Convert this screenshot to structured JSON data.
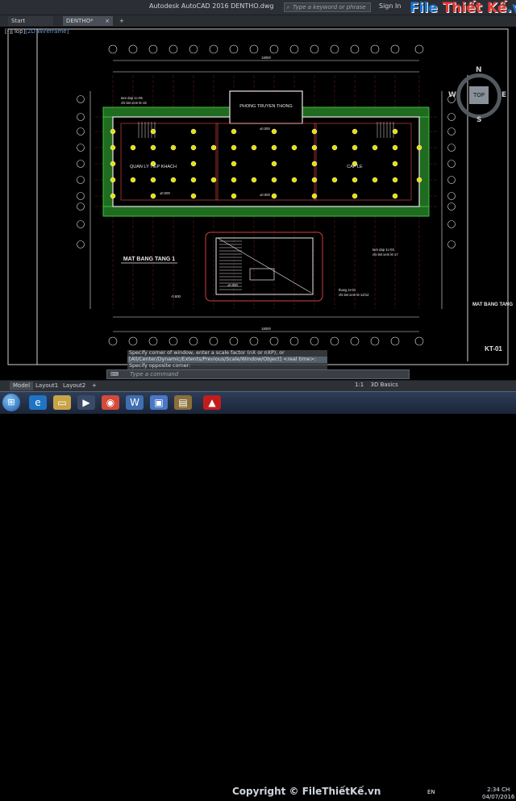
{
  "window": {
    "title": "Autodesk AutoCAD 2016    DENTHO.dwg",
    "search_placeholder": "Type a keyword or phrase",
    "sign_in": "Sign In",
    "logo_main": "File",
    "logo_accent": "Thiết Kế",
    "logo_suffix": ".vn"
  },
  "tabs": {
    "start": "Start",
    "drawing": "DENTHO*",
    "close": "×",
    "add": "+"
  },
  "viewport": {
    "view_label": "[-][Top]",
    "visual_style": "[2D Wireframe]",
    "viewcube": {
      "top": "TOP",
      "north": "N",
      "south": "S",
      "east": "E",
      "west": "W"
    }
  },
  "drawing": {
    "room_1": "PHONG TRUYEN THONG",
    "room_2": "QUAN LY TIEP KHACH",
    "room_3": "CAP LE",
    "plan_title": "MAT BANG TANG 1",
    "side_title": "MAT BANG TANG",
    "sheet_id": "KT-01",
    "note_1": "tam dap 1c-05",
    "note_1b": "chi tiet xem kt-18",
    "note_2": "tam dap 1c-03",
    "note_2b": "chi tiet xem kt-17",
    "note_3": "thang 1t-01",
    "note_3b": "chi tiet xem kt-12/14",
    "level_1": "±0.000",
    "level_2": "±0.000",
    "level_3": "±0.000",
    "level_4": "-0.600",
    "level_5": "±0.000",
    "dim_1": "18000",
    "dim_2": "18000"
  },
  "command": {
    "line1": "Specify corner of window, enter a scale factor (nX or nXP), or",
    "line2": "[All/Center/Dynamic/Extents/Previous/Scale/Window/Object] <real time>:",
    "line3": "Specify opposite corner:",
    "placeholder": "Type a command",
    "icon": "⌨"
  },
  "layout_tabs": {
    "model": "Model",
    "layout1": "Layout1",
    "layout2": "Layout2",
    "add": "+"
  },
  "status": {
    "scale": "1:1",
    "workspace": "3D Basics"
  },
  "taskbar": {
    "watermark": "Copyright © FileThiếtKế.vn",
    "lang": "EN",
    "time": "2:34 CH",
    "date": "04/07/2016"
  },
  "colors": {
    "walls": "#e8e8e8",
    "grid": "#c03030",
    "columns": "#e8e000",
    "hatch": "#2e9a2e",
    "accent": "#e31b1b"
  }
}
